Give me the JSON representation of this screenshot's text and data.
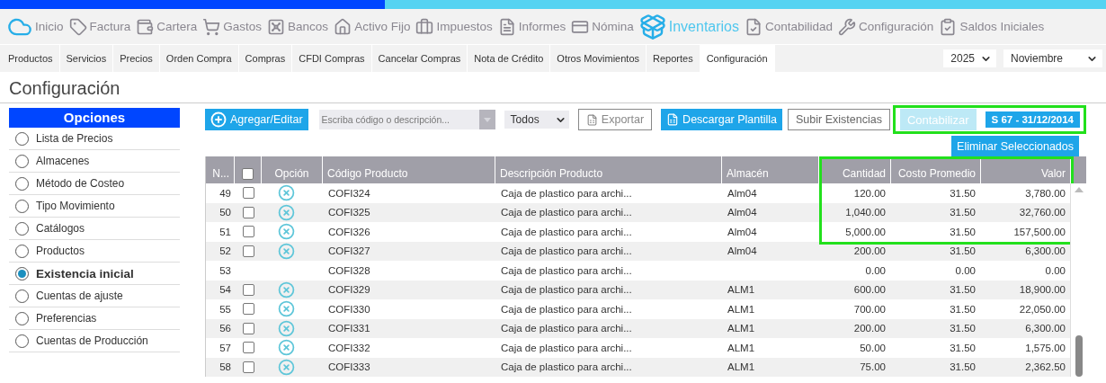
{
  "main_nav": [
    {
      "label": "Inicio",
      "selected": false
    },
    {
      "label": "Factura",
      "selected": false
    },
    {
      "label": "Cartera",
      "selected": false
    },
    {
      "label": "Gastos",
      "selected": false
    },
    {
      "label": "Bancos",
      "selected": false
    },
    {
      "label": "Activo Fijo",
      "selected": false
    },
    {
      "label": "Impuestos",
      "selected": false
    },
    {
      "label": "Informes",
      "selected": false
    },
    {
      "label": "Nómina",
      "selected": false
    },
    {
      "label": "Inventarios",
      "selected": true
    },
    {
      "label": "Contabilidad",
      "selected": false
    },
    {
      "label": "Configuración",
      "selected": false
    },
    {
      "label": "Saldos Iniciales",
      "selected": false
    }
  ],
  "sub_tabs": [
    {
      "label": "Productos",
      "selected": false
    },
    {
      "label": "Servicios",
      "selected": false
    },
    {
      "label": "Precios",
      "selected": false
    },
    {
      "label": "Orden Compra",
      "selected": false
    },
    {
      "label": "Compras",
      "selected": false
    },
    {
      "label": "CFDI Compras",
      "selected": false
    },
    {
      "label": "Cancelar Compras",
      "selected": false
    },
    {
      "label": "Nota de Crédito",
      "selected": false
    },
    {
      "label": "Otros Movimientos",
      "selected": false
    },
    {
      "label": "Reportes",
      "selected": false
    },
    {
      "label": "Configuración",
      "selected": true
    }
  ],
  "period": {
    "year": "2025",
    "month": "Noviembre"
  },
  "page_title": "Configuración",
  "sidebar": {
    "title": "Opciones",
    "items": [
      {
        "label": "Lista de Precios",
        "selected": false
      },
      {
        "label": "Almacenes",
        "selected": false
      },
      {
        "label": "Método de Costeo",
        "selected": false
      },
      {
        "label": "Tipo Movimiento",
        "selected": false
      },
      {
        "label": "Catálogos",
        "selected": false
      },
      {
        "label": "Productos",
        "selected": false
      },
      {
        "label": "Existencia inicial",
        "selected": true
      },
      {
        "label": "Cuentas de ajuste",
        "selected": false
      },
      {
        "label": "Preferencias",
        "selected": false
      },
      {
        "label": "Cuentas de Producción",
        "selected": false
      }
    ]
  },
  "toolbar": {
    "add_button": "Agregar/Editar",
    "search": {
      "placeholder": "Escriba código o descripción..."
    },
    "filter": "Todos",
    "export_button": "Exportar",
    "template_button": "Descargar Plantilla",
    "upload_button": "Subir Existencias",
    "post_button": {
      "label": "Contabilizar",
      "disabled": true
    },
    "policy_badge": "S 67 - 31/12/2014",
    "highlighted": true,
    "delete_button": "Eliminar Seleccionados"
  },
  "table": {
    "select_all_checked": false,
    "columns": [
      {
        "label": "N..."
      },
      {
        "kind": "checkbox"
      },
      {
        "label": "Opción"
      },
      {
        "label": "Código Producto"
      },
      {
        "label": "Descripción Producto"
      },
      {
        "label": "Almacén"
      },
      {
        "label": "Cantidad"
      },
      {
        "label": "Costo Promedio"
      },
      {
        "label": "Valor"
      }
    ],
    "totals_highlighted": true,
    "rows": [
      {
        "n": "49",
        "checked": false,
        "deletable": true,
        "code": "COFI324",
        "description": "Caja de plastico para archi...",
        "warehouse": "Alm04",
        "quantity": "120.00",
        "cost": "31.50",
        "value": "3,780.00"
      },
      {
        "n": "50",
        "checked": false,
        "deletable": true,
        "code": "COFI325",
        "description": "Caja de plastico para archi...",
        "warehouse": "Alm04",
        "quantity": "1,040.00",
        "cost": "31.50",
        "value": "32,760.00"
      },
      {
        "n": "51",
        "checked": false,
        "deletable": true,
        "code": "COFI326",
        "description": "Caja de plastico para archi...",
        "warehouse": "Alm04",
        "quantity": "5,000.00",
        "cost": "31.50",
        "value": "157,500.00"
      },
      {
        "n": "52",
        "checked": false,
        "deletable": true,
        "code": "COFI327",
        "description": "Caja de plastico para archi...",
        "warehouse": "Alm04",
        "quantity": "200.00",
        "cost": "31.50",
        "value": "6,300.00"
      },
      {
        "n": "53",
        "checked": null,
        "deletable": false,
        "code": "COFI328",
        "description": "Caja de plastico para archi...",
        "quantity": "0.00",
        "cost": "0.00",
        "value": "0.00"
      },
      {
        "n": "54",
        "checked": false,
        "deletable": true,
        "code": "COFI329",
        "description": "Caja de plastico para archi...",
        "warehouse": "ALM1",
        "quantity": "600.00",
        "cost": "31.50",
        "value": "18,900.00"
      },
      {
        "n": "55",
        "checked": false,
        "deletable": true,
        "code": "COFI330",
        "description": "Caja de plastico para archi...",
        "warehouse": "ALM1",
        "quantity": "700.00",
        "cost": "31.50",
        "value": "22,050.00"
      },
      {
        "n": "56",
        "checked": false,
        "deletable": true,
        "code": "COFI331",
        "description": "Caja de plastico para archi...",
        "warehouse": "ALM1",
        "quantity": "200.00",
        "cost": "31.50",
        "value": "6,300.00"
      },
      {
        "n": "57",
        "checked": false,
        "deletable": true,
        "code": "COFI332",
        "description": "Caja de plastico para archi...",
        "warehouse": "ALM1",
        "quantity": "50.00",
        "cost": "31.50",
        "value": "1,575.00"
      },
      {
        "n": "58",
        "checked": false,
        "deletable": true,
        "code": "COFI333",
        "description": "Caja de plastico para archi...",
        "warehouse": "ALM1",
        "quantity": "75.00",
        "cost": "31.50",
        "value": "2,362.50"
      }
    ]
  }
}
